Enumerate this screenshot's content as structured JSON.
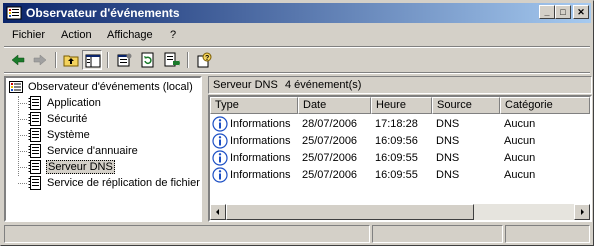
{
  "window": {
    "title": "Observateur d'événements",
    "minimize": "_",
    "maximize": "□",
    "close": "✕"
  },
  "menu": {
    "items": [
      {
        "label": "Fichier",
        "icon": ""
      },
      {
        "label": "Action",
        "icon": ""
      },
      {
        "label": "Affichage",
        "icon": ""
      },
      {
        "label": "?",
        "icon": ""
      }
    ]
  },
  "toolbar": {
    "buttons": [
      "back-icon",
      "forward-icon",
      "up-folder-icon",
      "show-hide-tree-icon",
      "properties-icon",
      "refresh-icon",
      "export-list-icon",
      "help-icon"
    ]
  },
  "tree": {
    "root": "Observateur d'événements (local)",
    "items": [
      {
        "label": "Application"
      },
      {
        "label": "Sécurité"
      },
      {
        "label": "Système"
      },
      {
        "label": "Service d'annuaire"
      },
      {
        "label": "Serveur DNS",
        "selected": true
      },
      {
        "label": "Service de réplication de fichiers"
      }
    ]
  },
  "panel": {
    "title": "Serveur DNS",
    "count": "4 événement(s)"
  },
  "list": {
    "columns": [
      "Type",
      "Date",
      "Heure",
      "Source",
      "Catégorie"
    ],
    "rows": [
      [
        "Informations",
        "28/07/2006",
        "17:18:28",
        "DNS",
        "Aucun"
      ],
      [
        "Informations",
        "25/07/2006",
        "16:09:56",
        "DNS",
        "Aucun"
      ],
      [
        "Informations",
        "25/07/2006",
        "16:09:55",
        "DNS",
        "Aucun"
      ],
      [
        "Informations",
        "25/07/2006",
        "16:09:55",
        "DNS",
        "Aucun"
      ]
    ]
  },
  "colors": {
    "title_start": "#0a246a",
    "title_end": "#a6caf0",
    "face": "#d4d0c8",
    "info_blue": "#1c4fc4"
  }
}
